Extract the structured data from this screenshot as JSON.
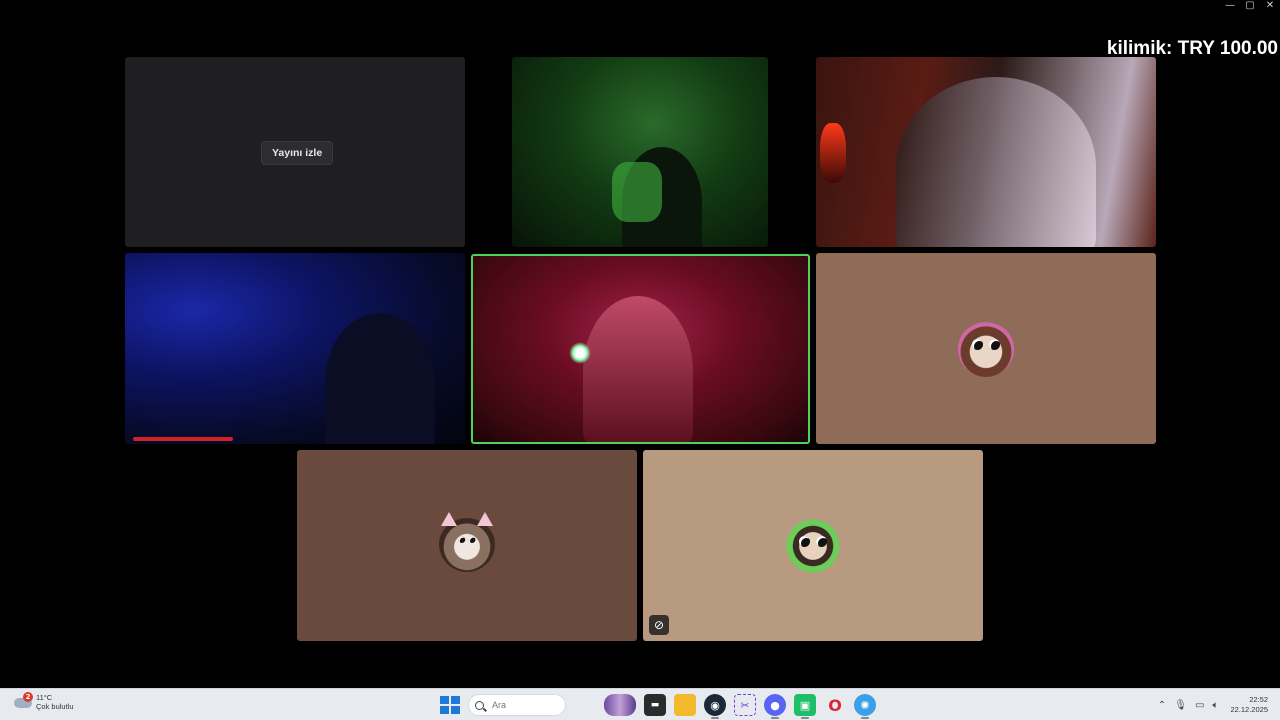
{
  "overlay": {
    "donation_text": "kilimik: TRY 100.00"
  },
  "window_controls": {
    "minimize": "—",
    "maximize": "▢",
    "close": "✕"
  },
  "call_grid": {
    "stream_tile": {
      "watch_button_label": "Yayını izle"
    },
    "active_speaker_color": "#4cd45a",
    "mute_indicator_icon": "mic-off-icon"
  },
  "taskbar": {
    "weather": {
      "temperature": "11°C",
      "condition": "Çok bulutlu",
      "badge_count": "2"
    },
    "search_placeholder": "Ara",
    "apps": [
      {
        "name": "start",
        "icon": "windows-logo-icon"
      },
      {
        "name": "game",
        "icon": "game-thumbnail-icon"
      },
      {
        "name": "terminal",
        "icon": "terminal-icon"
      },
      {
        "name": "file-explorer",
        "icon": "folder-icon"
      },
      {
        "name": "steam",
        "icon": "steam-icon"
      },
      {
        "name": "snipping-tool",
        "icon": "snip-icon"
      },
      {
        "name": "discord",
        "icon": "discord-icon"
      },
      {
        "name": "app-green",
        "icon": "green-app-icon"
      },
      {
        "name": "opera",
        "icon": "opera-icon"
      },
      {
        "name": "app-blue",
        "icon": "gear-app-icon"
      }
    ],
    "clock": {
      "time": "22:52",
      "date": "22.12.2025"
    }
  }
}
